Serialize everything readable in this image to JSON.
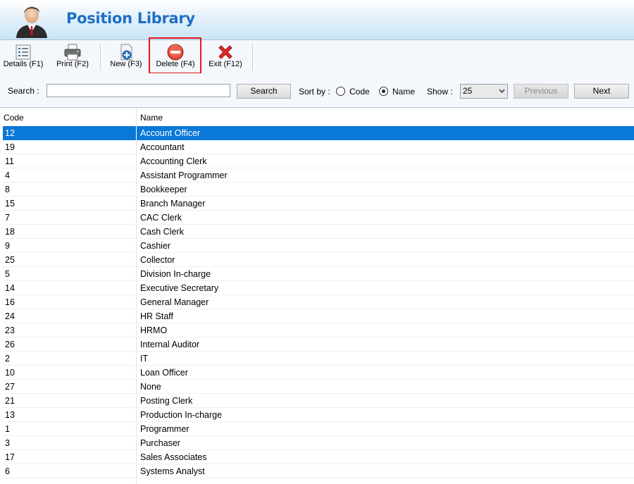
{
  "header": {
    "title": "Position Library",
    "avatar_icon": "businessman-icon"
  },
  "toolbar": {
    "details": {
      "label": "Details (F1)",
      "icon": "list-icon"
    },
    "print": {
      "label": "Print (F2)",
      "icon": "printer-icon"
    },
    "new": {
      "label": "New (F3)",
      "icon": "new-document-icon"
    },
    "delete": {
      "label": "Delete (F4)",
      "icon": "delete-icon"
    },
    "exit": {
      "label": "Exit (F12)",
      "icon": "close-icon"
    },
    "highlight_color": "#e41b1b"
  },
  "search": {
    "label": "Search :",
    "value": "",
    "button": "Search",
    "sort_label": "Sort by :",
    "sort_code": "Code",
    "sort_name": "Name",
    "sort_selected": "Name",
    "show_label": "Show :",
    "show_value": "25",
    "previous": "Previous",
    "next": "Next"
  },
  "grid": {
    "columns": [
      "Code",
      "Name"
    ],
    "selection_color": "#0a78d7",
    "rows": [
      {
        "code": "12",
        "name": "Account Officer"
      },
      {
        "code": "19",
        "name": "Accountant"
      },
      {
        "code": "11",
        "name": "Accounting Clerk"
      },
      {
        "code": "4",
        "name": "Assistant Programmer"
      },
      {
        "code": "8",
        "name": "Bookkeeper"
      },
      {
        "code": "15",
        "name": "Branch Manager"
      },
      {
        "code": "7",
        "name": "CAC Clerk"
      },
      {
        "code": "18",
        "name": "Cash Clerk"
      },
      {
        "code": "9",
        "name": "Cashier"
      },
      {
        "code": "25",
        "name": "Collector"
      },
      {
        "code": "5",
        "name": "Division In-charge"
      },
      {
        "code": "14",
        "name": "Executive Secretary"
      },
      {
        "code": "16",
        "name": "General Manager"
      },
      {
        "code": "24",
        "name": "HR Staff"
      },
      {
        "code": "23",
        "name": "HRMO"
      },
      {
        "code": "26",
        "name": "Internal Auditor"
      },
      {
        "code": "2",
        "name": "IT"
      },
      {
        "code": "10",
        "name": "Loan Officer"
      },
      {
        "code": "27",
        "name": "None"
      },
      {
        "code": "21",
        "name": "Posting Clerk"
      },
      {
        "code": "13",
        "name": "Production In-charge"
      },
      {
        "code": "1",
        "name": "Programmer"
      },
      {
        "code": "3",
        "name": "Purchaser"
      },
      {
        "code": "17",
        "name": "Sales Associates"
      },
      {
        "code": "6",
        "name": "Systems Analyst"
      }
    ]
  }
}
